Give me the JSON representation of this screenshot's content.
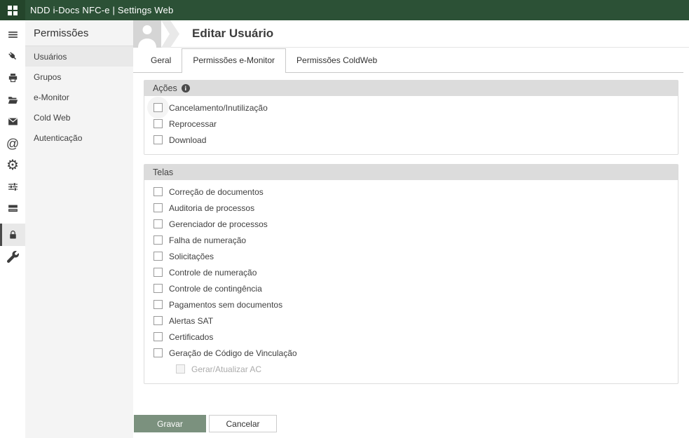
{
  "colors": {
    "topbar-bg": "#2C5136",
    "topbar-logo-bg": "#24452B",
    "accent-green": "#7B917E",
    "sidebar-bg": "#F4F4F4",
    "sidebar-selected-bg": "#E9E9E9",
    "section-header-bg": "#DCDCDC",
    "border-light": "#DDDDDD",
    "tab-border": "#C9C9C9",
    "text-disabled": "#ABABAB"
  },
  "topbar": {
    "title": "NDD i-Docs NFC-e | Settings Web"
  },
  "icon_rail": {
    "icons": [
      "menu",
      "plug",
      "printer",
      "folder-open",
      "envelope",
      "at-sign",
      "gear",
      "sliders",
      "server",
      "lock",
      "wrench"
    ],
    "active_icon": "lock"
  },
  "sidebar": {
    "title": "Permissões",
    "items": [
      {
        "label": "Usuários",
        "active": true
      },
      {
        "label": "Grupos",
        "active": false
      },
      {
        "label": "e-Monitor",
        "active": false
      },
      {
        "label": "Cold Web",
        "active": false
      },
      {
        "label": "Autenticação",
        "active": false
      }
    ]
  },
  "main": {
    "page_title": "Editar Usuário",
    "tabs": [
      {
        "label": "Geral",
        "active": false
      },
      {
        "label": "Permissões e-Monitor",
        "active": true
      },
      {
        "label": "Permissões ColdWeb",
        "active": false
      }
    ],
    "sections": [
      {
        "title": "Ações",
        "has_info_icon": true,
        "items": [
          {
            "label": "Cancelamento/Inutilização",
            "checked": false,
            "halo": true
          },
          {
            "label": "Reprocessar",
            "checked": false
          },
          {
            "label": "Download",
            "checked": false
          }
        ]
      },
      {
        "title": "Telas",
        "has_info_icon": false,
        "items": [
          {
            "label": "Correção de documentos",
            "checked": false
          },
          {
            "label": "Auditoria de processos",
            "checked": false
          },
          {
            "label": "Gerenciador de processos",
            "checked": false
          },
          {
            "label": "Falha de numeração",
            "checked": false
          },
          {
            "label": "Solicitações",
            "checked": false
          },
          {
            "label": "Controle de numeração",
            "checked": false
          },
          {
            "label": "Controle de contingência",
            "checked": false
          },
          {
            "label": "Pagamentos sem documentos",
            "checked": false
          },
          {
            "label": "Alertas SAT",
            "checked": false
          },
          {
            "label": "Certificados",
            "checked": false
          },
          {
            "label": "Geração de Código de Vinculação",
            "checked": false
          },
          {
            "label": "Gerar/Atualizar AC",
            "checked": false,
            "disabled": true,
            "indent": true
          }
        ]
      }
    ],
    "buttons": {
      "save": "Gravar",
      "cancel": "Cancelar"
    }
  }
}
